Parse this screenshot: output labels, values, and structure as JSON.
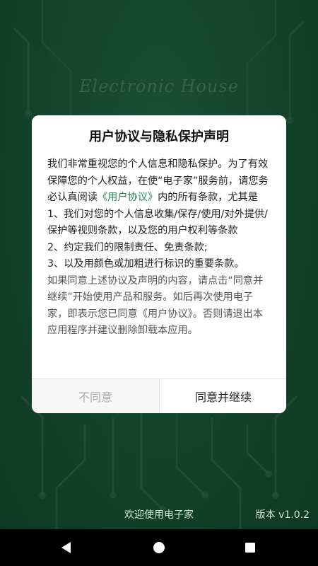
{
  "app": {
    "logo_text": "Electronic House",
    "welcome": "欢迎使用电子家",
    "version": "版本 v1.0.2"
  },
  "dialog": {
    "title": "用户协议与隐私保护声明",
    "para1_a": "我们非常重视您的个人信息和隐私保护。为了有效保障您的个人权益，在使“电子家”服务前，请您务必认真阅读",
    "para1_link": "《用户协议》",
    "para1_b": "内的所有条款，尤其是",
    "item1": "1、我们对您的个人信息收集/保存/使用/对外提供/保护等视则条款，以及您的用户权利等条款",
    "item2": "2、约定我们的限制责任、免责条款;",
    "item3": "3、以及用颜色或加粗进行标识的重要条款。",
    "para2": "如果同意上述协议及声明的内容，请点击“同意并继续”开始使用产品和服务。如后再次使用电子家，即表示您已同意《用户协议》。否则请退出本应用程序并建议删除卸载本应用。",
    "cancel_label": "不同意",
    "ok_label": "同意并继续"
  },
  "navbar": {
    "back_icon": "back-triangle-icon",
    "home_icon": "home-circle-icon",
    "recents_icon": "recents-square-icon"
  },
  "colors": {
    "background": "#1f6b45",
    "link": "#2a8a55"
  }
}
